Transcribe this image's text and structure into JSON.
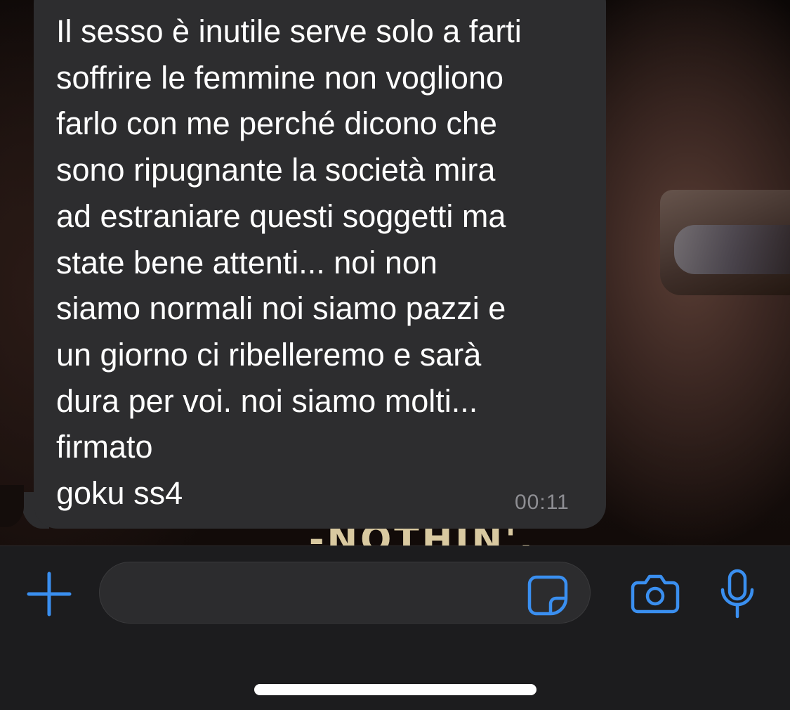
{
  "chat": {
    "wallpaper_caption": "-NOTHIN'.",
    "messages": [
      {
        "direction": "incoming",
        "text": "Il sesso è inutile serve solo a farti\nsoffrire le femmine non vogliono\nfarlo con me perché dicono che\nsono ripugnante la società mira\nad estraniare questi soggetti ma\nstate bene attenti... noi non\nsiamo normali noi siamo pazzi e\nun giorno ci ribelleremo e sarà\ndura per voi. noi siamo molti...\nfirmato\ngoku ss4",
        "time": "00:11"
      }
    ]
  },
  "input_bar": {
    "message_value": "",
    "icons": {
      "add": "plus-icon",
      "sticker": "sticker-icon",
      "camera": "camera-icon",
      "mic": "microphone-icon"
    }
  },
  "colors": {
    "accent": "#3a8ff0",
    "bubble": "#2d2d2f",
    "input_bar": "#1c1c1e",
    "timestamp": "#8e8e93"
  }
}
